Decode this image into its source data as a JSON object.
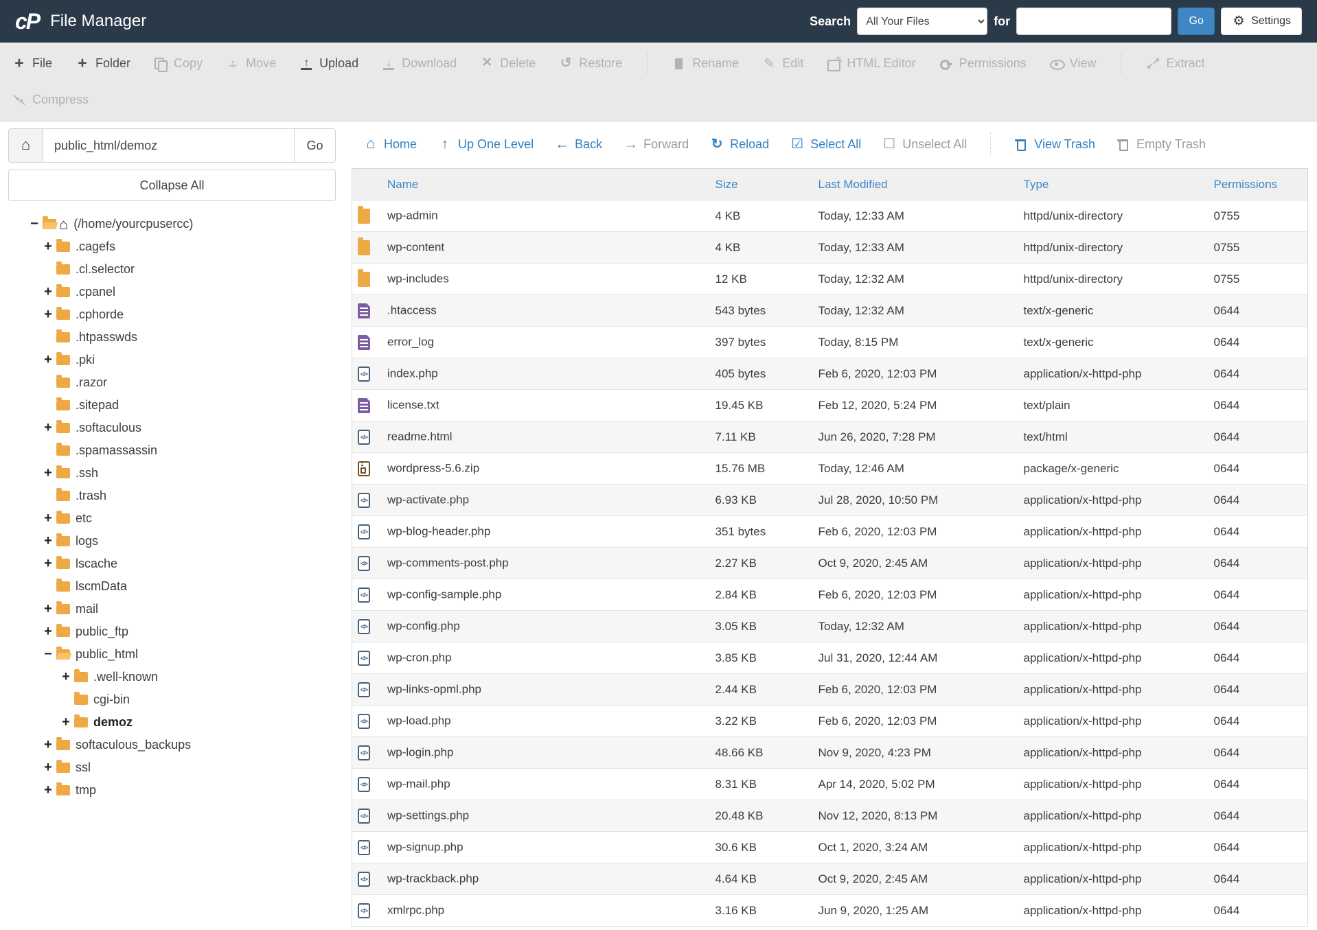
{
  "header": {
    "logo": "cP",
    "title": "File Manager",
    "search_label": "Search",
    "search_scope_selected": "All Your Files",
    "for_label": "for",
    "search_value": "",
    "go_label": "Go",
    "settings_label": "Settings"
  },
  "colors": {
    "header_bg": "#2b3a48",
    "accent_blue": "#3e86c4",
    "folder_orange": "#efa944",
    "toolbar_bg": "#e9e9e9",
    "disabled_gray": "#b2b2b2"
  },
  "toolbar": {
    "row1": [
      {
        "dn": "toolbar-item-file",
        "label": "File",
        "icon": "plus-icon",
        "cls": "",
        "disabled": false
      },
      {
        "dn": "toolbar-item-folder",
        "label": "Folder",
        "icon": "plus-icon",
        "cls": "",
        "disabled": false
      },
      {
        "dn": "toolbar-item-copy",
        "label": "Copy",
        "icon": "copy-icon",
        "cls": "disabled",
        "disabled": true
      },
      {
        "dn": "toolbar-item-move",
        "label": "Move",
        "icon": "move-icon",
        "cls": "disabled",
        "disabled": true
      },
      {
        "dn": "toolbar-item-upload",
        "label": "Upload",
        "icon": "upload-icon",
        "cls": "",
        "disabled": false
      },
      {
        "dn": "toolbar-item-download",
        "label": "Download",
        "icon": "download-icon",
        "cls": "disabled",
        "disabled": true
      },
      {
        "dn": "toolbar-item-delete",
        "label": "Delete",
        "icon": "delete-icon",
        "cls": "disabled",
        "disabled": true
      },
      {
        "dn": "toolbar-item-restore",
        "label": "Restore",
        "icon": "restore-icon",
        "cls": "disabled",
        "disabled": true
      },
      {
        "dn": "toolbar-separator",
        "label": "",
        "icon": "",
        "cls": "sep",
        "disabled": true
      },
      {
        "dn": "toolbar-item-rename",
        "label": "Rename",
        "icon": "rename-icon",
        "cls": "disabled",
        "disabled": true
      },
      {
        "dn": "toolbar-item-edit",
        "label": "Edit",
        "icon": "edit-icon",
        "cls": "disabled",
        "disabled": true
      },
      {
        "dn": "toolbar-item-html-editor",
        "label": "HTML Editor",
        "icon": "htmledit-icon",
        "cls": "disabled",
        "disabled": true
      },
      {
        "dn": "toolbar-item-permissions",
        "label": "Permissions",
        "icon": "key-icon",
        "cls": "disabled",
        "disabled": true
      },
      {
        "dn": "toolbar-item-view",
        "label": "View",
        "icon": "eye-icon",
        "cls": "disabled",
        "disabled": true
      },
      {
        "dn": "toolbar-separator",
        "label": "",
        "icon": "",
        "cls": "sep",
        "disabled": true
      },
      {
        "dn": "toolbar-item-extract",
        "label": "Extract",
        "icon": "extract-icon",
        "cls": "disabled",
        "disabled": true
      }
    ],
    "row2": [
      {
        "dn": "toolbar-item-compress",
        "label": "Compress",
        "icon": "compress-icon",
        "cls": "disabled",
        "disabled": true
      }
    ]
  },
  "sidebar": {
    "path_value": "public_html/demoz",
    "go_label": "Go",
    "collapse_label": "Collapse All",
    "tree": [
      {
        "cls": "lvl0",
        "exp": "−",
        "icon": "folder-open-icon",
        "home": "show",
        "label": "(/home/yourcpusercc)",
        "label_cls": ""
      },
      {
        "cls": "lvl1",
        "exp": "+",
        "icon": "folder-icon",
        "home": "",
        "label": ".cagefs",
        "label_cls": ""
      },
      {
        "cls": "lvl1",
        "exp": "",
        "icon": "folder-icon",
        "home": "",
        "label": ".cl.selector",
        "label_cls": ""
      },
      {
        "cls": "lvl1",
        "exp": "+",
        "icon": "folder-icon",
        "home": "",
        "label": ".cpanel",
        "label_cls": ""
      },
      {
        "cls": "lvl1",
        "exp": "+",
        "icon": "folder-icon",
        "home": "",
        "label": ".cphorde",
        "label_cls": ""
      },
      {
        "cls": "lvl1",
        "exp": "",
        "icon": "folder-icon",
        "home": "",
        "label": ".htpasswds",
        "label_cls": ""
      },
      {
        "cls": "lvl1",
        "exp": "+",
        "icon": "folder-icon",
        "home": "",
        "label": ".pki",
        "label_cls": ""
      },
      {
        "cls": "lvl1",
        "exp": "",
        "icon": "folder-icon",
        "home": "",
        "label": ".razor",
        "label_cls": ""
      },
      {
        "cls": "lvl1",
        "exp": "",
        "icon": "folder-icon",
        "home": "",
        "label": ".sitepad",
        "label_cls": ""
      },
      {
        "cls": "lvl1",
        "exp": "+",
        "icon": "folder-icon",
        "home": "",
        "label": ".softaculous",
        "label_cls": ""
      },
      {
        "cls": "lvl1",
        "exp": "",
        "icon": "folder-icon",
        "home": "",
        "label": ".spamassassin",
        "label_cls": ""
      },
      {
        "cls": "lvl1",
        "exp": "+",
        "icon": "folder-icon",
        "home": "",
        "label": ".ssh",
        "label_cls": ""
      },
      {
        "cls": "lvl1",
        "exp": "",
        "icon": "folder-icon",
        "home": "",
        "label": ".trash",
        "label_cls": ""
      },
      {
        "cls": "lvl1",
        "exp": "+",
        "icon": "folder-icon",
        "home": "",
        "label": "etc",
        "label_cls": ""
      },
      {
        "cls": "lvl1",
        "exp": "+",
        "icon": "folder-icon",
        "home": "",
        "label": "logs",
        "label_cls": ""
      },
      {
        "cls": "lvl1",
        "exp": "+",
        "icon": "folder-icon",
        "home": "",
        "label": "lscache",
        "label_cls": ""
      },
      {
        "cls": "lvl1",
        "exp": "",
        "icon": "folder-icon",
        "home": "",
        "label": "lscmData",
        "label_cls": ""
      },
      {
        "cls": "lvl1",
        "exp": "+",
        "icon": "folder-icon",
        "home": "",
        "label": "mail",
        "label_cls": ""
      },
      {
        "cls": "lvl1",
        "exp": "+",
        "icon": "folder-icon",
        "home": "",
        "label": "public_ftp",
        "label_cls": ""
      },
      {
        "cls": "lvl1",
        "exp": "−",
        "icon": "folder-open-icon",
        "home": "",
        "label": "public_html",
        "label_cls": ""
      },
      {
        "cls": "lvl2",
        "exp": "+",
        "icon": "folder-icon",
        "home": "",
        "label": ".well-known",
        "label_cls": ""
      },
      {
        "cls": "lvl2",
        "exp": "",
        "icon": "folder-icon",
        "home": "",
        "label": "cgi-bin",
        "label_cls": ""
      },
      {
        "cls": "lvl2",
        "exp": "+",
        "icon": "folder-icon",
        "home": "",
        "label": "demoz",
        "label_cls": "bold"
      },
      {
        "cls": "lvl1",
        "exp": "+",
        "icon": "folder-icon",
        "home": "",
        "label": "softaculous_backups",
        "label_cls": ""
      },
      {
        "cls": "lvl1",
        "exp": "+",
        "icon": "folder-icon",
        "home": "",
        "label": "ssl",
        "label_cls": ""
      },
      {
        "cls": "lvl1",
        "exp": "+",
        "icon": "folder-icon",
        "home": "",
        "label": "tmp",
        "label_cls": ""
      }
    ]
  },
  "nav": [
    {
      "dn": "nav-item-home",
      "label": "Home",
      "icon": "home-icon",
      "cls": "",
      "disabled": false
    },
    {
      "dn": "nav-item-up-one-level",
      "label": "Up One Level",
      "icon": "up-icon",
      "cls": "",
      "disabled": false
    },
    {
      "dn": "nav-item-back",
      "label": "Back",
      "icon": "back-icon",
      "cls": "",
      "disabled": false
    },
    {
      "dn": "nav-item-forward",
      "label": "Forward",
      "icon": "forward-icon",
      "cls": "gray",
      "disabled": true
    },
    {
      "dn": "nav-item-reload",
      "label": "Reload",
      "icon": "reload-icon",
      "cls": "",
      "disabled": false
    },
    {
      "dn": "nav-item-select-all",
      "label": "Select All",
      "icon": "selectall-icon",
      "cls": "",
      "disabled": false
    },
    {
      "dn": "nav-item-unselect-all",
      "label": "Unselect All",
      "icon": "unselect-icon",
      "cls": "gray",
      "disabled": true
    },
    {
      "dn": "nav-separator",
      "label": "",
      "icon": "",
      "cls": "sep",
      "disabled": true
    },
    {
      "dn": "nav-item-view-trash",
      "label": "View Trash",
      "icon": "trash-icon",
      "cls": "",
      "disabled": false
    },
    {
      "dn": "nav-item-empty-trash",
      "label": "Empty Trash",
      "icon": "trash-icon",
      "cls": "gray",
      "disabled": true
    }
  ],
  "table": {
    "columns": [
      {
        "label": "Name",
        "cls": "col-name"
      },
      {
        "label": "Size",
        "cls": "col-size"
      },
      {
        "label": "Last Modified",
        "cls": "col-mod"
      },
      {
        "label": "Type",
        "cls": "col-type"
      },
      {
        "label": "Permissions",
        "cls": "col-perm"
      }
    ],
    "rows": [
      {
        "icon": "folder-icon",
        "name": "wp-admin",
        "size": "4 KB",
        "modified": "Today, 12:33 AM",
        "type": "httpd/unix-directory",
        "perms": "0755"
      },
      {
        "icon": "folder-icon",
        "name": "wp-content",
        "size": "4 KB",
        "modified": "Today, 12:33 AM",
        "type": "httpd/unix-directory",
        "perms": "0755"
      },
      {
        "icon": "folder-icon",
        "name": "wp-includes",
        "size": "12 KB",
        "modified": "Today, 12:32 AM",
        "type": "httpd/unix-directory",
        "perms": "0755"
      },
      {
        "icon": "text-file-icon",
        "name": ".htaccess",
        "size": "543 bytes",
        "modified": "Today, 12:32 AM",
        "type": "text/x-generic",
        "perms": "0644"
      },
      {
        "icon": "text-file-icon",
        "name": "error_log",
        "size": "397 bytes",
        "modified": "Today, 8:15 PM",
        "type": "text/x-generic",
        "perms": "0644"
      },
      {
        "icon": "code-file-icon",
        "name": "index.php",
        "size": "405 bytes",
        "modified": "Feb 6, 2020, 12:03 PM",
        "type": "application/x-httpd-php",
        "perms": "0644"
      },
      {
        "icon": "text-file-icon",
        "name": "license.txt",
        "size": "19.45 KB",
        "modified": "Feb 12, 2020, 5:24 PM",
        "type": "text/plain",
        "perms": "0644"
      },
      {
        "icon": "code-file-icon",
        "name": "readme.html",
        "size": "7.11 KB",
        "modified": "Jun 26, 2020, 7:28 PM",
        "type": "text/html",
        "perms": "0644"
      },
      {
        "icon": "zip-file-icon",
        "name": "wordpress-5.6.zip",
        "size": "15.76 MB",
        "modified": "Today, 12:46 AM",
        "type": "package/x-generic",
        "perms": "0644"
      },
      {
        "icon": "code-file-icon",
        "name": "wp-activate.php",
        "size": "6.93 KB",
        "modified": "Jul 28, 2020, 10:50 PM",
        "type": "application/x-httpd-php",
        "perms": "0644"
      },
      {
        "icon": "code-file-icon",
        "name": "wp-blog-header.php",
        "size": "351 bytes",
        "modified": "Feb 6, 2020, 12:03 PM",
        "type": "application/x-httpd-php",
        "perms": "0644"
      },
      {
        "icon": "code-file-icon",
        "name": "wp-comments-post.php",
        "size": "2.27 KB",
        "modified": "Oct 9, 2020, 2:45 AM",
        "type": "application/x-httpd-php",
        "perms": "0644"
      },
      {
        "icon": "code-file-icon",
        "name": "wp-config-sample.php",
        "size": "2.84 KB",
        "modified": "Feb 6, 2020, 12:03 PM",
        "type": "application/x-httpd-php",
        "perms": "0644"
      },
      {
        "icon": "code-file-icon",
        "name": "wp-config.php",
        "size": "3.05 KB",
        "modified": "Today, 12:32 AM",
        "type": "application/x-httpd-php",
        "perms": "0644"
      },
      {
        "icon": "code-file-icon",
        "name": "wp-cron.php",
        "size": "3.85 KB",
        "modified": "Jul 31, 2020, 12:44 AM",
        "type": "application/x-httpd-php",
        "perms": "0644"
      },
      {
        "icon": "code-file-icon",
        "name": "wp-links-opml.php",
        "size": "2.44 KB",
        "modified": "Feb 6, 2020, 12:03 PM",
        "type": "application/x-httpd-php",
        "perms": "0644"
      },
      {
        "icon": "code-file-icon",
        "name": "wp-load.php",
        "size": "3.22 KB",
        "modified": "Feb 6, 2020, 12:03 PM",
        "type": "application/x-httpd-php",
        "perms": "0644"
      },
      {
        "icon": "code-file-icon",
        "name": "wp-login.php",
        "size": "48.66 KB",
        "modified": "Nov 9, 2020, 4:23 PM",
        "type": "application/x-httpd-php",
        "perms": "0644"
      },
      {
        "icon": "code-file-icon",
        "name": "wp-mail.php",
        "size": "8.31 KB",
        "modified": "Apr 14, 2020, 5:02 PM",
        "type": "application/x-httpd-php",
        "perms": "0644"
      },
      {
        "icon": "code-file-icon",
        "name": "wp-settings.php",
        "size": "20.48 KB",
        "modified": "Nov 12, 2020, 8:13 PM",
        "type": "application/x-httpd-php",
        "perms": "0644"
      },
      {
        "icon": "code-file-icon",
        "name": "wp-signup.php",
        "size": "30.6 KB",
        "modified": "Oct 1, 2020, 3:24 AM",
        "type": "application/x-httpd-php",
        "perms": "0644"
      },
      {
        "icon": "code-file-icon",
        "name": "wp-trackback.php",
        "size": "4.64 KB",
        "modified": "Oct 9, 2020, 2:45 AM",
        "type": "application/x-httpd-php",
        "perms": "0644"
      },
      {
        "icon": "code-file-icon",
        "name": "xmlrpc.php",
        "size": "3.16 KB",
        "modified": "Jun 9, 2020, 1:25 AM",
        "type": "application/x-httpd-php",
        "perms": "0644"
      }
    ]
  }
}
